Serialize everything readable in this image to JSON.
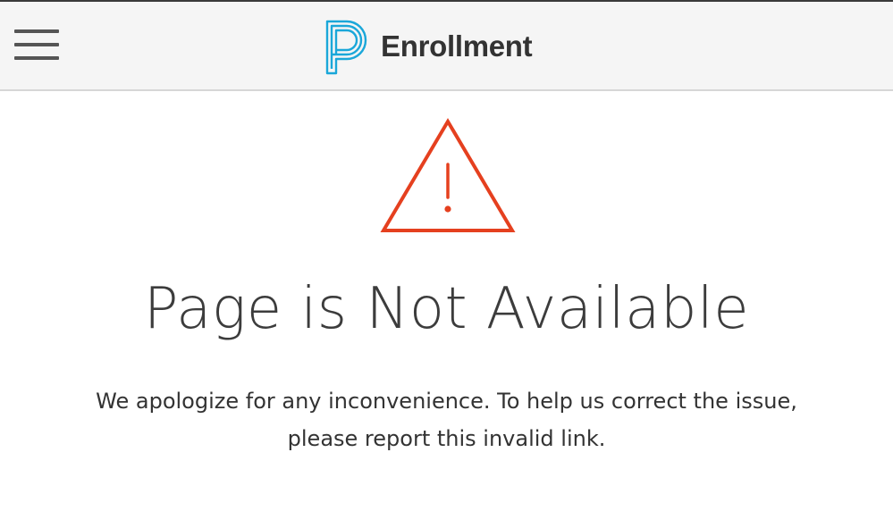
{
  "header": {
    "brand_name": "Enrollment",
    "brand_color": "#1aa7d9",
    "menu_icon": "hamburger-menu-icon"
  },
  "main": {
    "icon": "warning-triangle-icon",
    "icon_color": "#e5401f",
    "title": "Page is Not Available",
    "message_line1": "We apologize for any inconvenience. To help us correct the issue,",
    "message_line2": "please report this invalid link."
  }
}
